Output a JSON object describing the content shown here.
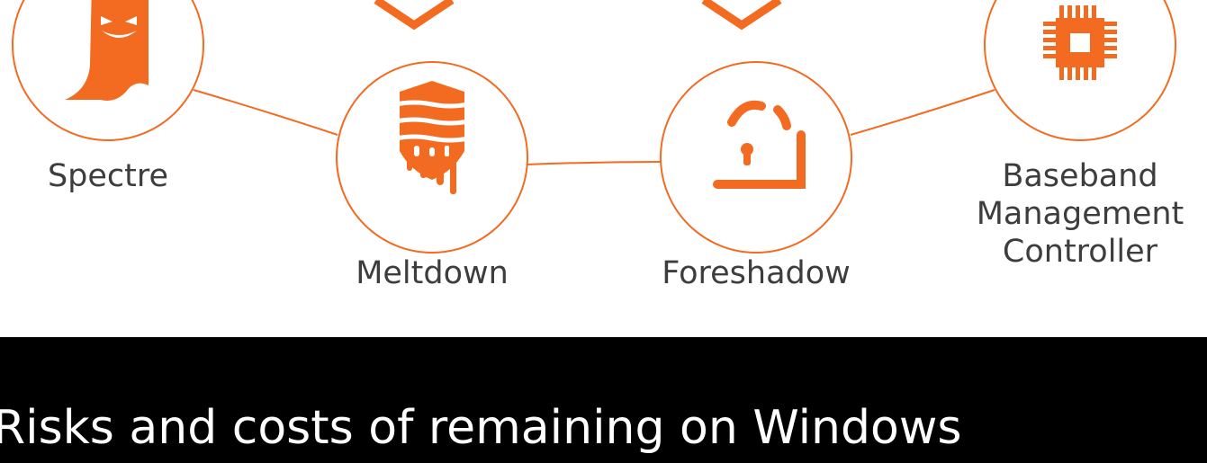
{
  "nodes": {
    "spectre": {
      "label": "Spectre",
      "icon": "ghost-icon"
    },
    "meltdown": {
      "label": "Meltdown",
      "icon": "melting-shield-icon"
    },
    "foreshadow": {
      "label": "Foreshadow",
      "icon": "open-padlock-icon"
    },
    "bmc": {
      "label_lines": [
        "Baseband",
        "Management",
        "Controller"
      ],
      "icon": "microchip-icon"
    }
  },
  "caption": "Risks and costs of remaining on Windows",
  "colors": {
    "accent": "#F26B21",
    "text": "#3D3D3D",
    "caption_background": "#000000",
    "caption_text": "#FFFFFF",
    "background": "#FFFFFF"
  }
}
